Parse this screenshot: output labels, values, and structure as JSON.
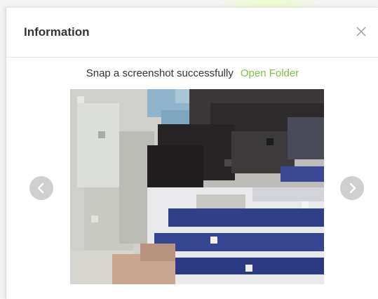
{
  "dialog": {
    "title": "Information",
    "close_icon": "close-icon"
  },
  "message": {
    "text": "Snap a screenshot successfully",
    "link_label": "Open Folder",
    "link_color": "#7cc242"
  },
  "preview": {
    "pixelated": true
  },
  "navigation": {
    "prev_icon": "chevron-left-icon",
    "next_icon": "chevron-right-icon"
  }
}
